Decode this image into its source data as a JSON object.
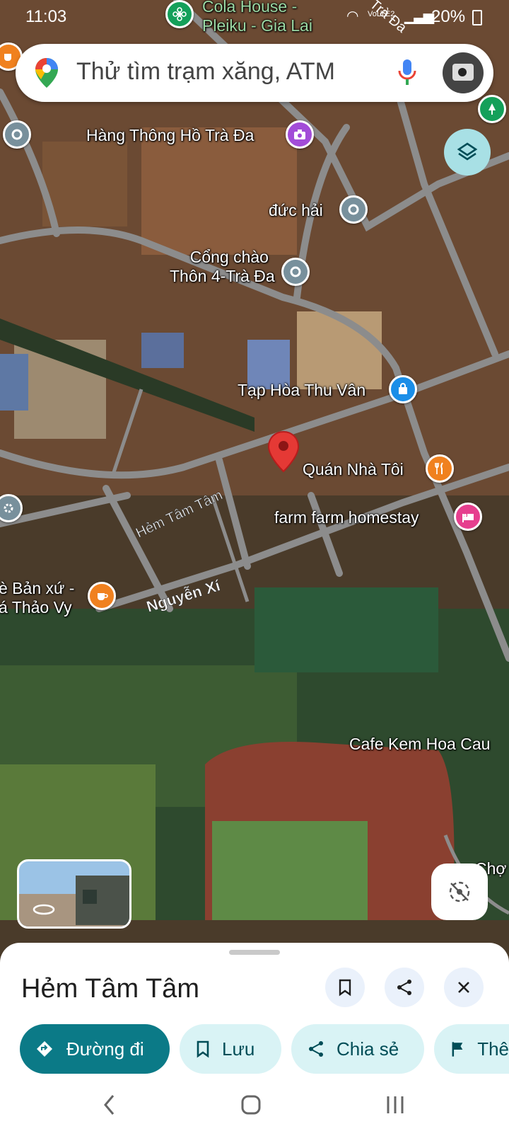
{
  "status_bar": {
    "time": "11:03",
    "battery": "20%",
    "network": "VoLTE2"
  },
  "search": {
    "placeholder": "Thử tìm trạm xăng, ATM"
  },
  "map_labels": {
    "cola_house_line1": "Cola House -",
    "cola_house_line2": "Pleiku - Gia Lai",
    "road_top": "Trà Đa",
    "hang_thong": "Hàng Thông Hồ Trà Đa",
    "duc_hai": "đức hải",
    "cong_chao_line1": "Cổng chào",
    "cong_chao_line2": "Thôn 4-Trà Đa",
    "tap_hoa": "Tạp Hòa Thu Vân",
    "quan_nha_toi": "Quán Nhà Tôi",
    "farm_homestay": "farm farm homestay",
    "hem_tam_tam": "Hẻm Tâm Tâm",
    "nguyen_xi": "Nguyễn Xí",
    "ban_xu_line1": "è Bản xứ -",
    "ban_xu_line2": "á Thảo Vy",
    "cafe_kem": "Cafe Kem Hoa Cau",
    "cho": "Chợ"
  },
  "place": {
    "title": "Hẻm Tâm Tâm"
  },
  "actions": {
    "directions": "Đường đi",
    "save": "Lưu",
    "share": "Chia sẻ",
    "more": "Thê"
  },
  "colors": {
    "primary": "#0b7a87",
    "chip_bg": "#d9f3f5",
    "pin_red": "#e53935",
    "poi_gray": "#78909c",
    "poi_orange": "#f0811f",
    "poi_pink": "#e63f8e",
    "poi_blue": "#1a8ee8",
    "poi_purple": "#a24cd8",
    "poi_green": "#14a05a"
  },
  "icons": [
    "google-maps-icon",
    "mic-icon",
    "layers-icon",
    "locate-icon",
    "bookmark-icon",
    "share-icon",
    "close-icon",
    "directions-icon",
    "flag-icon",
    "back-icon",
    "home-icon",
    "recents-icon"
  ]
}
